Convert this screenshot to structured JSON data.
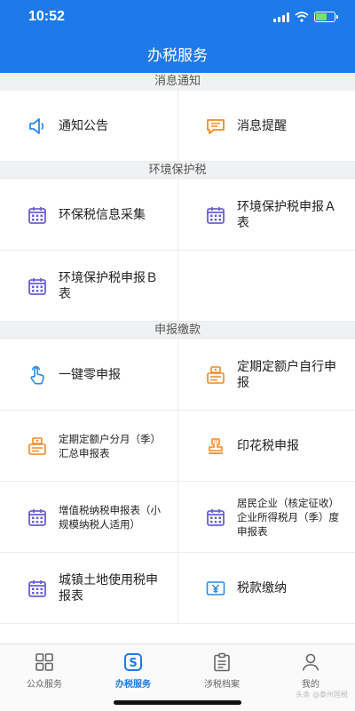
{
  "status_bar": {
    "time": "10:52"
  },
  "header": {
    "title": "办税服务"
  },
  "sections": [
    {
      "title": "消息通知",
      "items": [
        {
          "label": "通知公告",
          "icon": "speaker-icon"
        },
        {
          "label": "消息提醒",
          "icon": "message-bubble-icon"
        }
      ]
    },
    {
      "title": "环境保护税",
      "items": [
        {
          "label": "环保税信息采集",
          "icon": "calendar-icon"
        },
        {
          "label": "环境保护税申报Ａ表",
          "icon": "calendar-icon"
        },
        {
          "label": "环境保护税申报Ｂ表",
          "icon": "calendar-icon"
        }
      ]
    },
    {
      "title": "申报缴款",
      "items": [
        {
          "label": "一键零申报",
          "icon": "tap-hand-icon"
        },
        {
          "label": "定期定额户自行申报",
          "icon": "cash-register-icon"
        },
        {
          "label": "定期定额户分月（季）汇总申报表",
          "icon": "cash-register-icon"
        },
        {
          "label": "印花税申报",
          "icon": "stamp-icon"
        },
        {
          "label": "增值税纳税申报表（小规模纳税人适用）",
          "icon": "calendar-icon"
        },
        {
          "label": "居民企业（核定征收）企业所得税月（季）度申报表",
          "icon": "calendar-icon"
        },
        {
          "label": "城镇土地使用税申报表",
          "icon": "calendar-icon"
        },
        {
          "label": "税款缴纳",
          "icon": "yuan-payment-icon"
        }
      ]
    }
  ],
  "tabbar": {
    "active": 1,
    "tabs": [
      {
        "label": "公众服务",
        "icon": "grid-icon"
      },
      {
        "label": "办税服务",
        "icon": "s-badge-icon"
      },
      {
        "label": "涉税档案",
        "icon": "clipboard-icon"
      },
      {
        "label": "我的",
        "icon": "user-icon"
      }
    ]
  },
  "colors": {
    "primary": "#1e7ae8",
    "icon_purple": "#6a5fd6",
    "icon_orange": "#f08a24",
    "icon_blue": "#2b8ae6",
    "text": "#222222"
  },
  "watermark": "头条 @泰州国税"
}
